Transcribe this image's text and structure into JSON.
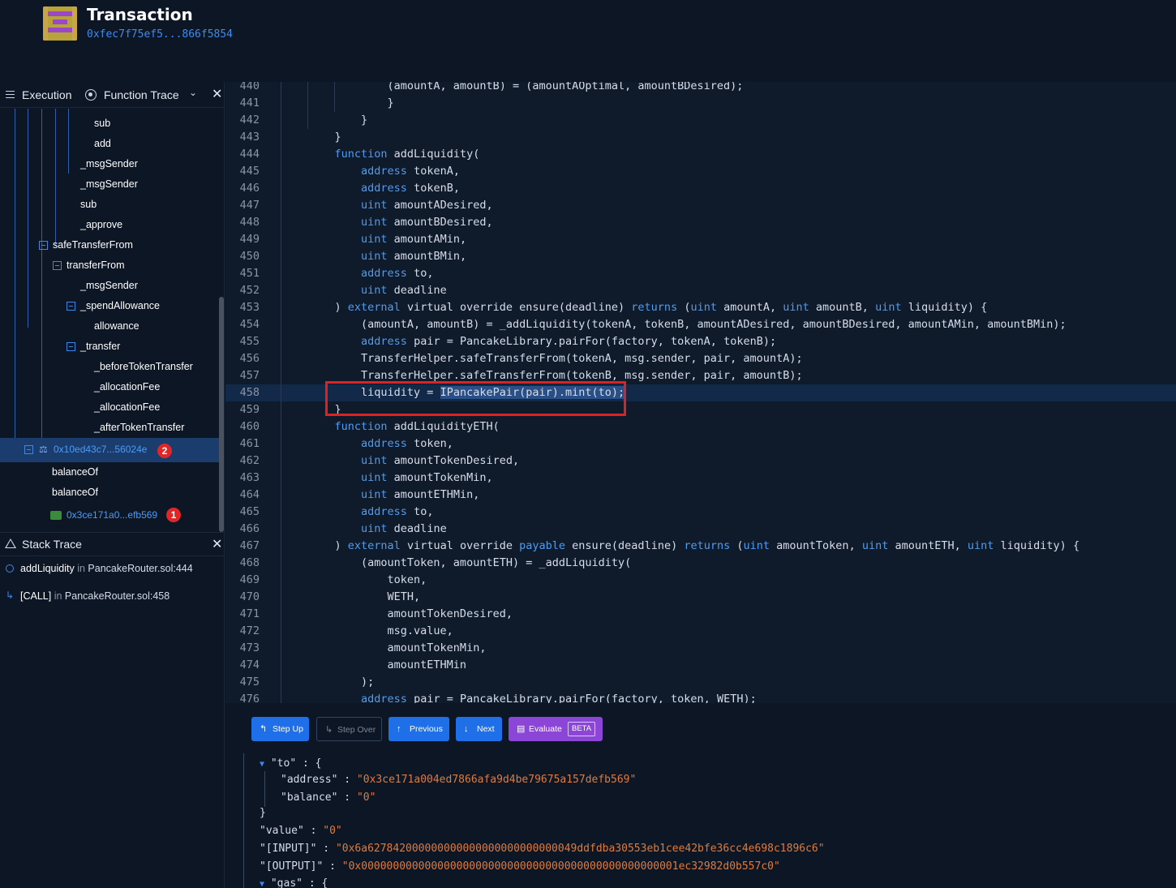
{
  "header": {
    "title": "Transaction",
    "hash": "0xfec7f75ef5...866f5854"
  },
  "execution_panel": {
    "execution_label": "Execution",
    "function_trace_label": "Function Trace",
    "close_label": "✕"
  },
  "trace_tree": [
    {
      "label": "sub",
      "indent": 5
    },
    {
      "label": "add",
      "indent": 5
    },
    {
      "label": "_msgSender",
      "indent": 4
    },
    {
      "label": "_msgSender",
      "indent": 4
    },
    {
      "label": "sub",
      "indent": 4
    },
    {
      "label": "_approve",
      "indent": 4
    },
    {
      "label": "safeTransferFrom",
      "indent": 2,
      "box": true
    },
    {
      "label": "transferFrom",
      "indent": 3,
      "box": true
    },
    {
      "label": "_msgSender",
      "indent": 4
    },
    {
      "label": "_spendAllowance",
      "indent": 4,
      "box": true
    },
    {
      "label": "allowance",
      "indent": 5
    },
    {
      "label": "_transfer",
      "indent": 4,
      "box": true
    },
    {
      "label": "_beforeTokenTransfer",
      "indent": 5
    },
    {
      "label": "_allocationFee",
      "indent": 5
    },
    {
      "label": "_allocationFee",
      "indent": 5
    },
    {
      "label": "_afterTokenTransfer",
      "indent": 5
    }
  ],
  "trace_selected": {
    "label": "0x10ed43c7...56024e",
    "badge": "2"
  },
  "trace_after": [
    {
      "label": "balanceOf"
    },
    {
      "label": "balanceOf"
    }
  ],
  "trace_last": {
    "label": "0x3ce171a0...efb569",
    "badge": "1"
  },
  "stack_panel": {
    "title": "Stack Trace",
    "close_label": "✕",
    "items": [
      {
        "fn": "addLiquidity",
        "in": "in",
        "file": "PancakeRouter.sol:444"
      },
      {
        "fn": "[CALL]",
        "in": "in",
        "file": "PancakeRouter.sol:458"
      }
    ]
  },
  "code": {
    "highlight_line": "458",
    "lines": [
      {
        "n": "440",
        "t": "            (amountA, amountB) = (amountAOptimal, amountBDesired);",
        "d": 3
      },
      {
        "n": "441",
        "t": "            }",
        "d": 3
      },
      {
        "n": "442",
        "t": "        }",
        "d": 2
      },
      {
        "n": "443",
        "t": "    }",
        "d": 1
      },
      {
        "n": "444",
        "t": "    function addLiquidity(",
        "d": 1
      },
      {
        "n": "445",
        "t": "        address tokenA,",
        "d": 1
      },
      {
        "n": "446",
        "t": "        address tokenB,",
        "d": 1
      },
      {
        "n": "447",
        "t": "        uint amountADesired,",
        "d": 1
      },
      {
        "n": "448",
        "t": "        uint amountBDesired,",
        "d": 1
      },
      {
        "n": "449",
        "t": "        uint amountAMin,",
        "d": 1
      },
      {
        "n": "450",
        "t": "        uint amountBMin,",
        "d": 1
      },
      {
        "n": "451",
        "t": "        address to,",
        "d": 1
      },
      {
        "n": "452",
        "t": "        uint deadline",
        "d": 1
      },
      {
        "n": "453",
        "t": "    ) external virtual override ensure(deadline) returns (uint amountA, uint amountB, uint liquidity) {",
        "d": 1
      },
      {
        "n": "454",
        "t": "        (amountA, amountB) = _addLiquidity(tokenA, tokenB, amountADesired, amountBDesired, amountAMin, amountBMin);",
        "d": 1
      },
      {
        "n": "455",
        "t": "        address pair = PancakeLibrary.pairFor(factory, tokenA, tokenB);",
        "d": 1
      },
      {
        "n": "456",
        "t": "        TransferHelper.safeTransferFrom(tokenA, msg.sender, pair, amountA);",
        "d": 1
      },
      {
        "n": "457",
        "t": "        TransferHelper.safeTransferFrom(tokenB, msg.sender, pair, amountB);",
        "d": 1
      },
      {
        "n": "458",
        "t": "        liquidity = IPancakePair(pair).mint(to);",
        "d": 1
      },
      {
        "n": "459",
        "t": "    }",
        "d": 1
      },
      {
        "n": "460",
        "t": "    function addLiquidityETH(",
        "d": 1
      },
      {
        "n": "461",
        "t": "        address token,",
        "d": 1
      },
      {
        "n": "462",
        "t": "        uint amountTokenDesired,",
        "d": 1
      },
      {
        "n": "463",
        "t": "        uint amountTokenMin,",
        "d": 1
      },
      {
        "n": "464",
        "t": "        uint amountETHMin,",
        "d": 1
      },
      {
        "n": "465",
        "t": "        address to,",
        "d": 1
      },
      {
        "n": "466",
        "t": "        uint deadline",
        "d": 1
      },
      {
        "n": "467",
        "t": "    ) external virtual override payable ensure(deadline) returns (uint amountToken, uint amountETH, uint liquidity) {",
        "d": 1
      },
      {
        "n": "468",
        "t": "        (amountToken, amountETH) = _addLiquidity(",
        "d": 1
      },
      {
        "n": "469",
        "t": "            token,",
        "d": 1
      },
      {
        "n": "470",
        "t": "            WETH,",
        "d": 1
      },
      {
        "n": "471",
        "t": "            amountTokenDesired,",
        "d": 1
      },
      {
        "n": "472",
        "t": "            msg.value,",
        "d": 1
      },
      {
        "n": "473",
        "t": "            amountTokenMin,",
        "d": 1
      },
      {
        "n": "474",
        "t": "            amountETHMin",
        "d": 1
      },
      {
        "n": "475",
        "t": "        );",
        "d": 1
      },
      {
        "n": "476",
        "t": "        address pair = PancakeLibrary.pairFor(factory, token, WETH);",
        "d": 1
      }
    ],
    "keywords": [
      "function",
      "address",
      "uint",
      "external",
      "returns",
      "payable"
    ]
  },
  "controls": {
    "step_up": "Step Up",
    "step_over": "Step Over",
    "previous": "Previous",
    "next": "Next",
    "evaluate": "Evaluate",
    "beta": "BETA"
  },
  "json_output": {
    "to_key": "\"to\"",
    "address_key": "\"address\"",
    "address_val": "\"0x3ce171a004ed7866afa9d4be79675a157defb569\"",
    "balance_key": "\"balance\"",
    "balance_val": "\"0\"",
    "value_key": "\"value\"",
    "value_val": "\"0\"",
    "input_key": "\"[INPUT]\"",
    "input_val": "\"0x6a627842000000000000000000000000049ddfdba30553eb1cee42bfe36cc4e698c1896c6\"",
    "output_key": "\"[OUTPUT]\"",
    "output_val": "\"0x00000000000000000000000000000000000000000000000001ec32982d0b557c0\"",
    "gas_key": "\"gas\""
  },
  "colors": {
    "accent": "#1f6fe8",
    "evaluate": "#8b46d8",
    "highlight_border": "#dd2222",
    "string_value": "#e07b3c",
    "keyword": "#4f9cf0",
    "badge": "#e02626"
  },
  "icons": [
    "menu-icon",
    "function-trace-icon",
    "chevron-down-icon",
    "close-icon",
    "warning-icon",
    "contract-icon",
    "wallet-icon"
  ]
}
